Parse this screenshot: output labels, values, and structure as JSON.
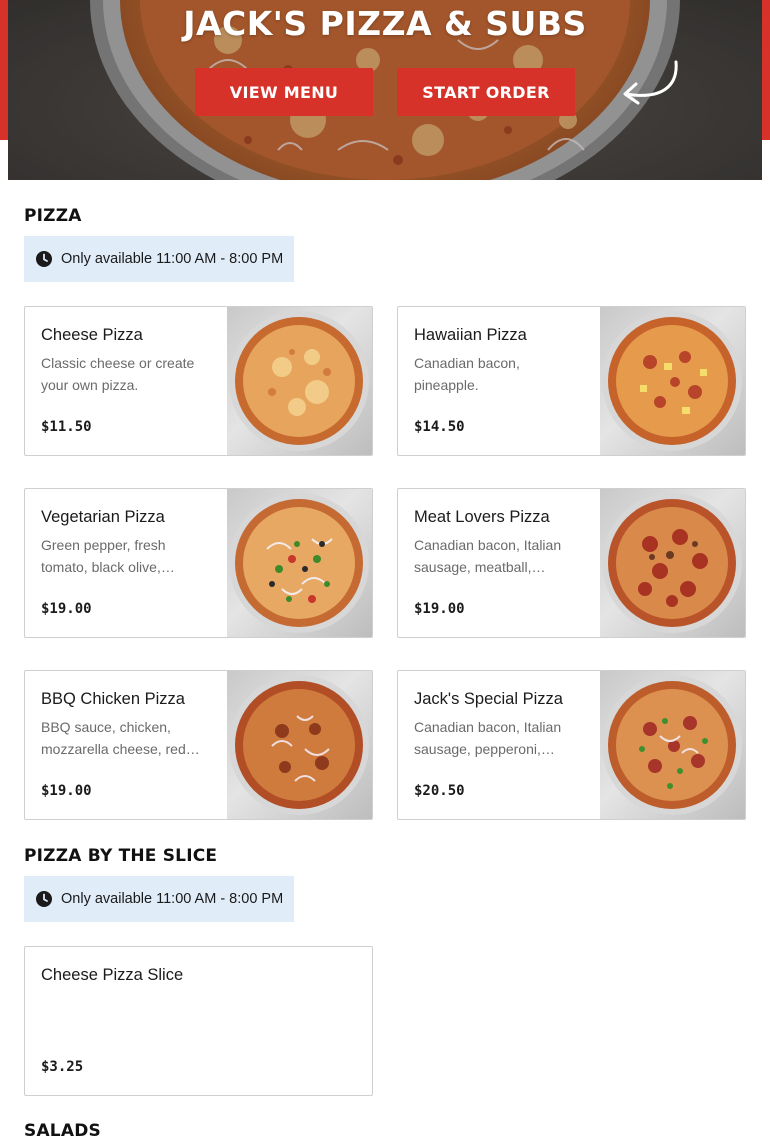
{
  "restaurant": {
    "name": "JACK'S PIZZA & SUBS",
    "view_menu_label": "VIEW MENU",
    "start_order_label": "START ORDER"
  },
  "colors": {
    "brand_red": "#d7322a",
    "availability_bg": "#e1ecf9"
  },
  "sections": [
    {
      "title": "PIZZA",
      "availability": "Only available 11:00 AM - 8:00 PM",
      "items": [
        {
          "name": "Cheese Pizza",
          "description": "Classic cheese or create your own pizza.",
          "price": "$11.50",
          "image": "cheese-pizza-image"
        },
        {
          "name": "Hawaiian Pizza",
          "description": "Canadian bacon, pineapple.",
          "price": "$14.50",
          "image": "hawaiian-pizza-image"
        },
        {
          "name": "Vegetarian Pizza",
          "description": "Green pepper, fresh tomato, black olive,…",
          "price": "$19.00",
          "image": "vegetarian-pizza-image"
        },
        {
          "name": "Meat Lovers Pizza",
          "description": "Canadian bacon, Italian sausage, meatball,…",
          "price": "$19.00",
          "image": "meat-lovers-pizza-image"
        },
        {
          "name": "BBQ Chicken Pizza",
          "description": "BBQ sauce, chicken, mozzarella cheese, red…",
          "price": "$19.00",
          "image": "bbq-chicken-pizza-image"
        },
        {
          "name": "Jack's Special Pizza",
          "description": "Canadian bacon, Italian sausage, pepperoni, blac…",
          "price": "$20.50",
          "image": "jacks-special-pizza-image"
        }
      ]
    },
    {
      "title": "PIZZA BY THE SLICE",
      "availability": "Only available 11:00 AM - 8:00 PM",
      "items": [
        {
          "name": "Cheese Pizza Slice",
          "description": "",
          "price": "$3.25"
        }
      ]
    },
    {
      "title": "SALADS"
    }
  ]
}
